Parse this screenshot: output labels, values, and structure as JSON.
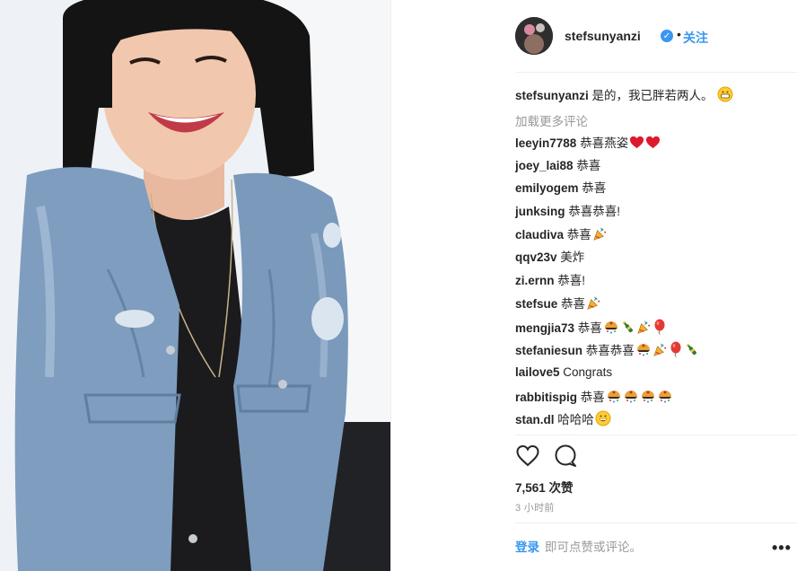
{
  "post": {
    "username": "stefsunyanzi",
    "follow_label": "关注",
    "separator": "•"
  },
  "caption": {
    "username": "stefsunyanzi",
    "text": "是的，我已胖若两人。"
  },
  "load_more": "加载更多评论",
  "comments": [
    {
      "user": "leeyin7788",
      "text": "恭喜燕姿",
      "emoji": [
        "red-heart-icon",
        "red-heart-icon"
      ]
    },
    {
      "user": "joey_lai88",
      "text": "恭喜",
      "emoji": []
    },
    {
      "user": "emilyogem",
      "text": "恭喜",
      "emoji": []
    },
    {
      "user": "junksing",
      "text": "恭喜恭喜!",
      "emoji": []
    },
    {
      "user": "claudiva",
      "text": "恭喜",
      "emoji": [
        "party-popper-icon"
      ]
    },
    {
      "user": "qqv23v",
      "text": "美炸",
      "emoji": []
    },
    {
      "user": "zi.ernn",
      "text": "恭喜!",
      "emoji": []
    },
    {
      "user": "stefsue",
      "text": "恭喜",
      "emoji": [
        "party-popper-icon"
      ]
    },
    {
      "user": "mengjia73",
      "text": "恭喜",
      "emoji": [
        "confetti-ball-icon",
        "champagne-icon",
        "party-popper-icon",
        "balloon-icon"
      ]
    },
    {
      "user": "stefaniesun",
      "text": "恭喜恭喜",
      "emoji": [
        "confetti-ball-icon",
        "party-popper-icon",
        "balloon-icon",
        "champagne-icon"
      ]
    },
    {
      "user": "lailove5",
      "text": "Congrats",
      "emoji": []
    },
    {
      "user": "rabbitispig",
      "text": "恭喜",
      "emoji": [
        "confetti-ball-icon",
        "confetti-ball-icon",
        "confetti-ball-icon",
        "confetti-ball-icon"
      ]
    },
    {
      "user": "stan.dl",
      "text": "哈哈哈",
      "emoji": [
        "grinning-face-icon"
      ]
    }
  ],
  "likes": "7,561 次赞",
  "time": "3 小时前",
  "footer": {
    "login": "登录",
    "text": "即可点赞或评论。",
    "more": "•••"
  },
  "icons": {
    "like": "heart-outline-icon",
    "comment": "comment-bubble-icon",
    "verified": "verified-badge-icon",
    "more": "more-options-icon"
  },
  "colors": {
    "accent": "#3897f0",
    "text": "#262626",
    "muted": "#999999",
    "divider": "#efefef"
  }
}
